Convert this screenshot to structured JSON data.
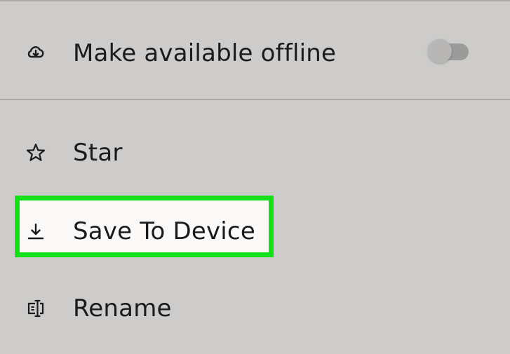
{
  "menu": {
    "offline": {
      "label": "Make available offline",
      "icon": "cloud-download-icon",
      "toggle_on": false
    },
    "star": {
      "label": "Star",
      "icon": "star-icon"
    },
    "save": {
      "label": "Save To Device",
      "icon": "download-icon",
      "highlighted": true
    },
    "rename": {
      "label": "Rename",
      "icon": "rename-icon"
    }
  },
  "colors": {
    "background": "#cdcccb",
    "highlight_border": "#14e01a",
    "highlight_fill": "#fbf9f7",
    "text": "#1b1b1b"
  }
}
